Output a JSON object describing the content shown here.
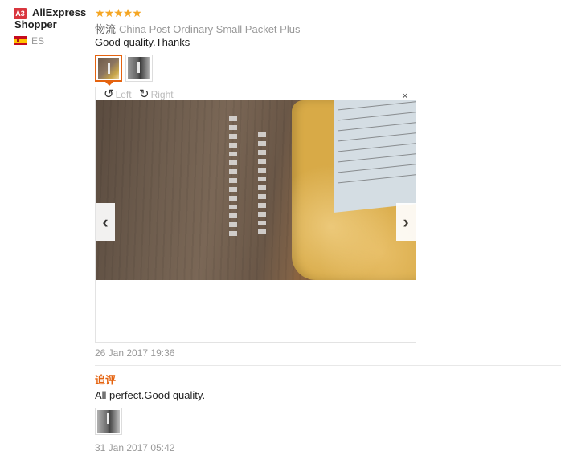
{
  "user": {
    "badge": "A3",
    "name": "AliExpress Shopper",
    "country": "ES"
  },
  "review": {
    "stars": [
      "★",
      "★",
      "★",
      "★",
      "★"
    ],
    "rating": 5,
    "logistics_label": "物流",
    "logistics_value": "China Post Ordinary Small Packet Plus",
    "feedback": "Good quality.Thanks",
    "date": "26 Jan 2017 19:36"
  },
  "viewer": {
    "rotate_left": "Left",
    "rotate_right": "Right",
    "rotate_left_icon": "↺",
    "rotate_right_icon": "↻",
    "close_icon": "×",
    "prev_icon": "‹",
    "next_icon": "›"
  },
  "additional": {
    "title": "追评",
    "feedback": "All perfect.Good quality.",
    "date": "31 Jan 2017 05:42"
  },
  "colors": {
    "accent": "#e5630f",
    "star": "#f5a623",
    "badge": "#d9363e"
  }
}
